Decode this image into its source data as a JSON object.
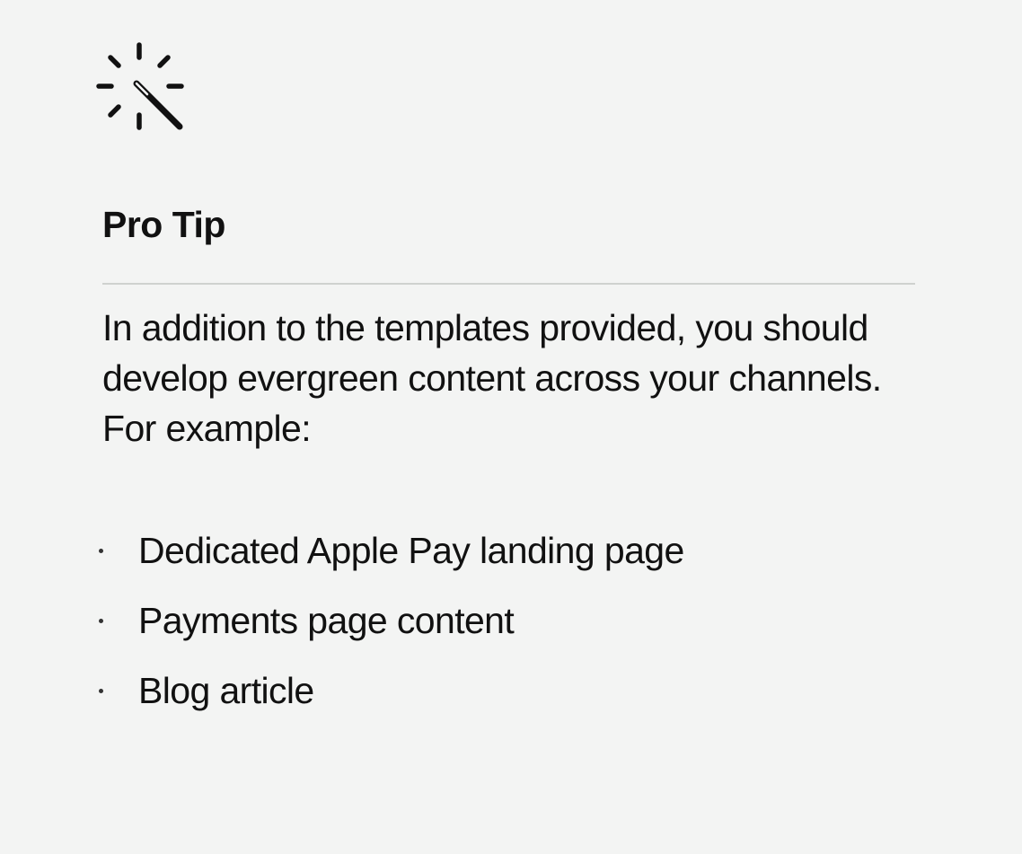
{
  "icon": "magic-wand-sparkle-icon",
  "title": "Pro Tip",
  "body": "In addition to the templates provided, you should develop evergreen content across your channels. For example:",
  "items": [
    {
      "label": "Dedicated Apple Pay landing page"
    },
    {
      "label": "Payments page content"
    },
    {
      "label": "Blog article"
    }
  ],
  "colors": {
    "background": "#f3f4f3",
    "text": "#111111",
    "divider": "#cfd1cf"
  }
}
